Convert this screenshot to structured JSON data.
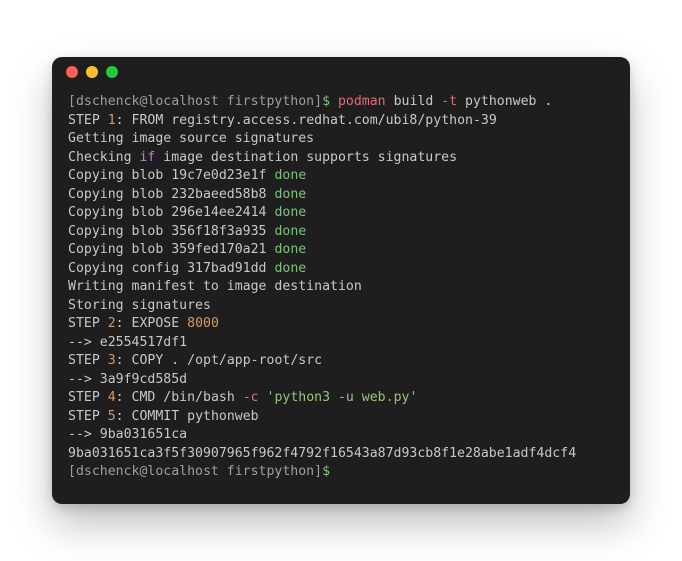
{
  "prompt": {
    "user_host": "[dschenck@localhost firstpython]",
    "dollar": "$"
  },
  "command": {
    "cmd": "podman",
    "sub": " build ",
    "flag_t": "-t",
    "rest": " pythonweb ."
  },
  "step1": {
    "prefix": "STEP ",
    "num": "1",
    "colon": ":",
    "rest": " FROM registry.access.redhat.com/ubi8/python-39"
  },
  "line_get_sigs": "Getting image source signatures",
  "line_checking_pre": "Checking ",
  "line_checking_kw": "if",
  "line_checking_post": " image destination supports signatures",
  "blobs": [
    {
      "pre": "Copying blob 19c7e0d23e1f ",
      "done": "done"
    },
    {
      "pre": "Copying blob 232baeed58b8 ",
      "done": "done"
    },
    {
      "pre": "Copying blob 296e14ee2414 ",
      "done": "done"
    },
    {
      "pre": "Copying blob 356f18f3a935 ",
      "done": "done"
    },
    {
      "pre": "Copying blob 359fed170a21 ",
      "done": "done"
    },
    {
      "pre": "Copying config 317bad91dd ",
      "done": "done"
    }
  ],
  "line_manifest": "Writing manifest to image destination",
  "line_storing": "Storing signatures",
  "step2": {
    "prefix": "STEP ",
    "num": "2",
    "colon": ":",
    "mid": " EXPOSE ",
    "port": "8000"
  },
  "arrow1": {
    "dash": "--",
    "rest": "> e2554517df1"
  },
  "step3": {
    "prefix": "STEP ",
    "num": "3",
    "colon": ":",
    "rest": " COPY . /opt/app-root/src"
  },
  "arrow2": {
    "dash": "--",
    "rest": "> 3a9f9cd585d"
  },
  "step4": {
    "prefix": "STEP ",
    "num": "4",
    "colon": ":",
    "mid": " CMD /bin/bash ",
    "flag_c": "-c ",
    "str": "'python3 -u web.py'"
  },
  "step5": {
    "prefix": "STEP ",
    "num": "5",
    "colon": ":",
    "rest": " COMMIT pythonweb"
  },
  "arrow3": {
    "dash": "--",
    "rest": "> 9ba031651ca"
  },
  "hash_line": "9ba031651ca3f5f30907965f962f4792f16543a87d93cb8f1e28abe1adf4dcf4"
}
